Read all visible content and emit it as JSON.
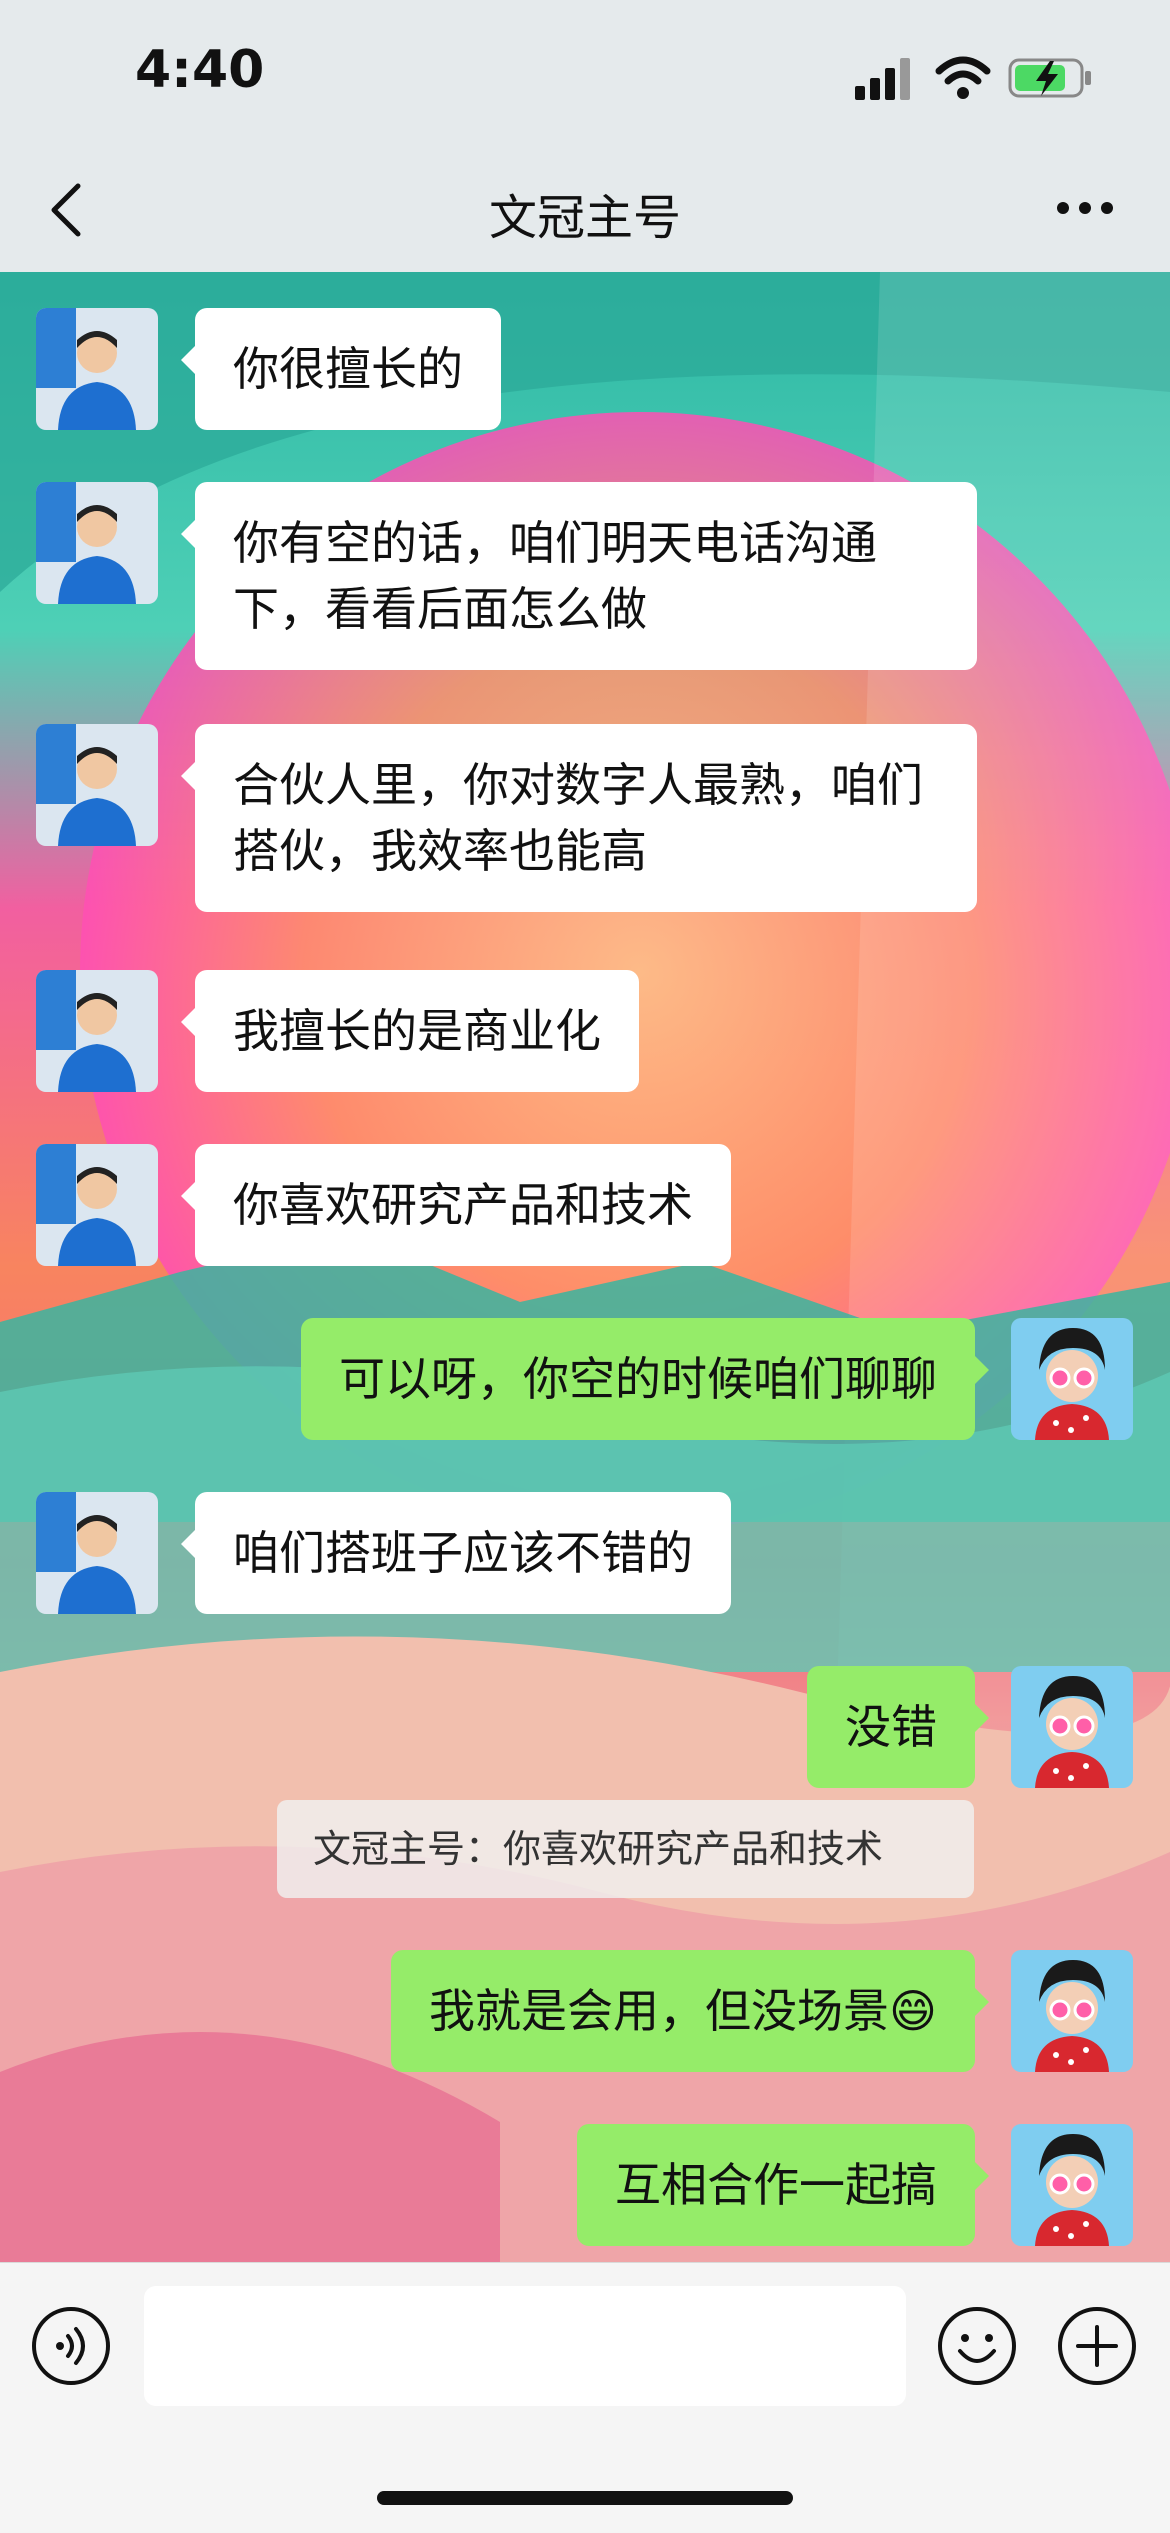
{
  "status_bar": {
    "time": "4:40",
    "icons": [
      "signal-icon",
      "wifi-icon",
      "battery-charging-icon"
    ]
  },
  "header": {
    "title": "文冠主号",
    "back_icon": "chevron-left-icon",
    "more_icon": "more-icon"
  },
  "messages": [
    {
      "sender": "them",
      "text": "你很擅长的"
    },
    {
      "sender": "them",
      "text": "你有空的话，咱们明天电话沟通下，看看后面怎么做"
    },
    {
      "sender": "them",
      "text": "合伙人里，你对数字人最熟，咱们搭伙，我效率也能高"
    },
    {
      "sender": "them",
      "text": "我擅长的是商业化"
    },
    {
      "sender": "them",
      "text": "你喜欢研究产品和技术"
    },
    {
      "sender": "me",
      "text": "可以呀，你空的时候咱们聊聊"
    },
    {
      "sender": "them",
      "text": "咱们搭班子应该不错的"
    },
    {
      "sender": "me",
      "text": "没错"
    },
    {
      "sender": "me",
      "text": "我就是会用，但没场景😄",
      "quote": "文冠主号：你喜欢研究产品和技术"
    },
    {
      "sender": "me",
      "text": "互相合作一起搞"
    }
  ],
  "input_bar": {
    "value": "",
    "icons": [
      "voice-icon",
      "emoji-icon",
      "plus-icon"
    ]
  },
  "colors": {
    "my_bubble": "#95ec69",
    "their_bubble": "#ffffff",
    "header_bg": "#e5eaec"
  }
}
